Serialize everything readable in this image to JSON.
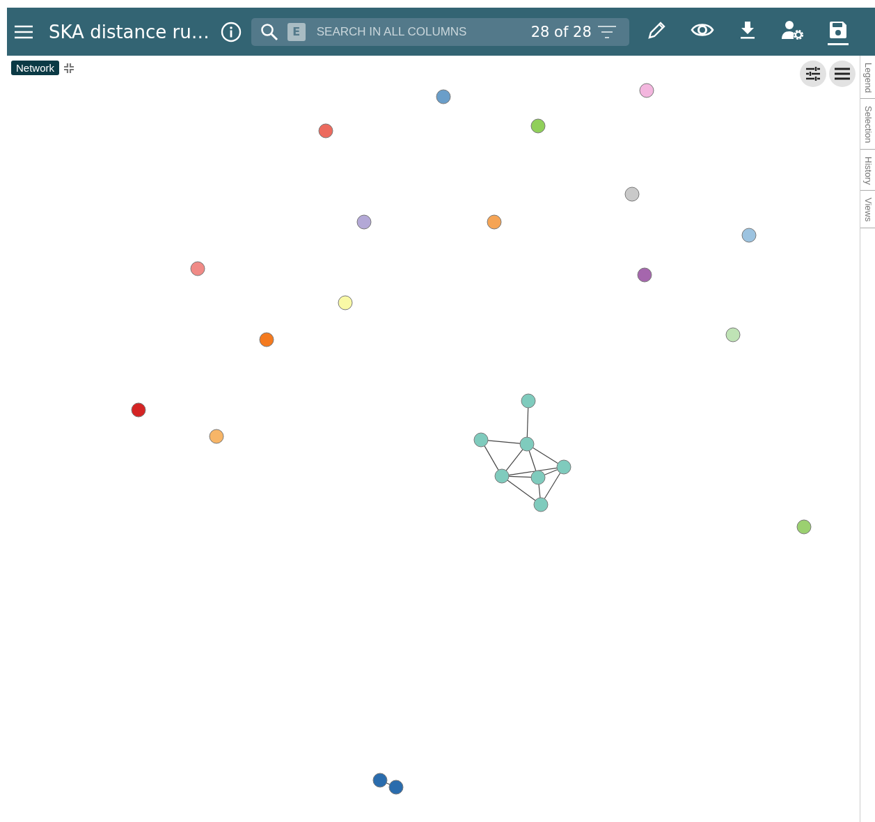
{
  "header": {
    "title": "SKA distance ru…",
    "search": {
      "placeholder": "SEARCH IN ALL COLUMNS",
      "mode_key": "E",
      "count": "28 of 28"
    },
    "toolbar": [
      {
        "kind": "edit",
        "selected": false
      },
      {
        "kind": "view",
        "selected": false
      },
      {
        "kind": "download",
        "selected": false
      },
      {
        "kind": "user-settings",
        "selected": false
      },
      {
        "kind": "save",
        "selected": true
      }
    ]
  },
  "view_badge": "Network",
  "network": {
    "nodes": [
      {
        "color": "#6a9ec9"
      },
      {
        "color": "#f3b6de"
      },
      {
        "color": "#ec6a5e"
      },
      {
        "color": "#90cf5a"
      },
      {
        "color": "#c9c9c9"
      },
      {
        "color": "#b3a8d6"
      },
      {
        "color": "#f5a455"
      },
      {
        "color": "#9cc3e0"
      },
      {
        "color": "#f08a86"
      },
      {
        "color": "#a566ad"
      },
      {
        "color": "#f9f9a6"
      },
      {
        "color": "#f47a1f"
      },
      {
        "color": "#bfe3b5"
      },
      {
        "color": "#d42424"
      },
      {
        "color": "#f7b567"
      },
      {
        "color": "#9bd070"
      },
      {
        "color": "#7fcbbd"
      },
      {
        "color": "#7fcbbd"
      },
      {
        "color": "#7fcbbd"
      },
      {
        "color": "#7fcbbd"
      },
      {
        "color": "#7fcbbd"
      },
      {
        "color": "#7fcbbd"
      },
      {
        "color": "#7fcbbd"
      },
      {
        "color": "#2a6cad"
      },
      {
        "color": "#2a6cad"
      }
    ]
  },
  "side_tabs": [
    {
      "label": "Legend",
      "selected": false
    },
    {
      "label": "Selection",
      "selected": false
    },
    {
      "label": "History",
      "selected": false
    },
    {
      "label": "Views",
      "selected": false
    }
  ]
}
